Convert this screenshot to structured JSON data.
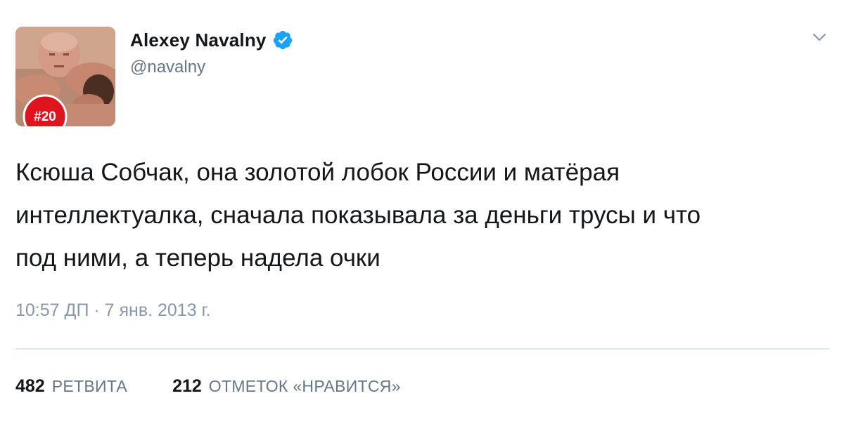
{
  "tweet": {
    "author": {
      "display_name": "Alexey Navalny",
      "handle": "@navalny",
      "verified": true,
      "avatar_badge": "#20"
    },
    "text": "Ксюша Собчак, она золотой лобок России и матёрая\nинтеллектуалка, сначала показывала за деньги трусы и что\nпод ними, а теперь надела очки",
    "timestamp": "10:57 ДП · 7 янв. 2013 г.",
    "stats": {
      "retweets": {
        "count": "482",
        "label": "РЕТВИТА"
      },
      "likes": {
        "count": "212",
        "label": "ОТМЕТОК «НРАВИТСЯ»"
      }
    },
    "icons": {
      "verified": "verified-badge-icon",
      "menu": "chevron-down-icon"
    },
    "colors": {
      "verified_blue": "#1da1f2",
      "secondary_text": "#657786",
      "badge_red": "#e0141e"
    }
  }
}
